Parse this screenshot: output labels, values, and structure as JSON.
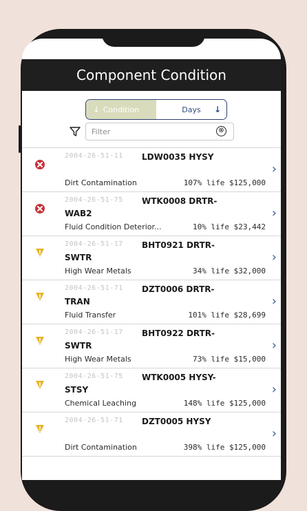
{
  "header": {
    "title": "Component Condition"
  },
  "sort": {
    "condition_label": "Condition",
    "days_label": "Days",
    "condition_arrow": "↓",
    "days_arrow": "↓"
  },
  "filter": {
    "placeholder": "Filter",
    "clear_glyph": "⊗"
  },
  "items": [
    {
      "id": "2004-26-51-11",
      "code": "LDW0035 HYSY",
      "code2": "",
      "status": "error",
      "desc": "Dirt Contamination",
      "metric": "107% life $125,000"
    },
    {
      "id": "2004-26-51-75",
      "code": "WTK0008 DRTR-",
      "code2": "WAB2",
      "status": "error",
      "desc": "Fluid Condition Deterior...",
      "metric": "10% life $23,442"
    },
    {
      "id": "2004-26-51-17",
      "code": "BHT0921 DRTR-",
      "code2": "SWTR",
      "status": "warning",
      "desc": "High Wear Metals",
      "metric": "34% life $32,000"
    },
    {
      "id": "2004-26-51-71",
      "code": "DZT0006 DRTR-",
      "code2": "TRAN",
      "status": "warning",
      "desc": "Fluid Transfer",
      "metric": "101% life $28,699"
    },
    {
      "id": "2004-26-51-17",
      "code": "BHT0922 DRTR-",
      "code2": "SWTR",
      "status": "warning",
      "desc": "High Wear Metals",
      "metric": "73% life $15,000"
    },
    {
      "id": "2004-26-51-75",
      "code": "WTK0005 HYSY-",
      "code2": "STSY",
      "status": "warning",
      "desc": "Chemical Leaching",
      "metric": "148% life $125,000"
    },
    {
      "id": "2004-26-51-71",
      "code": "DZT0005 HYSY",
      "code2": "",
      "status": "warning",
      "desc": "Dirt Contamination",
      "metric": "398% life $125,000"
    }
  ],
  "colors": {
    "error": "#c8323a",
    "warning": "#e6b323",
    "chevron": "#3a57a0",
    "header": "#1f1f1f"
  },
  "icons": {
    "error": "x-circle-icon",
    "warning": "warning-funnel-icon",
    "chevron": "chevron-right-icon",
    "filter": "filter-funnel-icon"
  }
}
